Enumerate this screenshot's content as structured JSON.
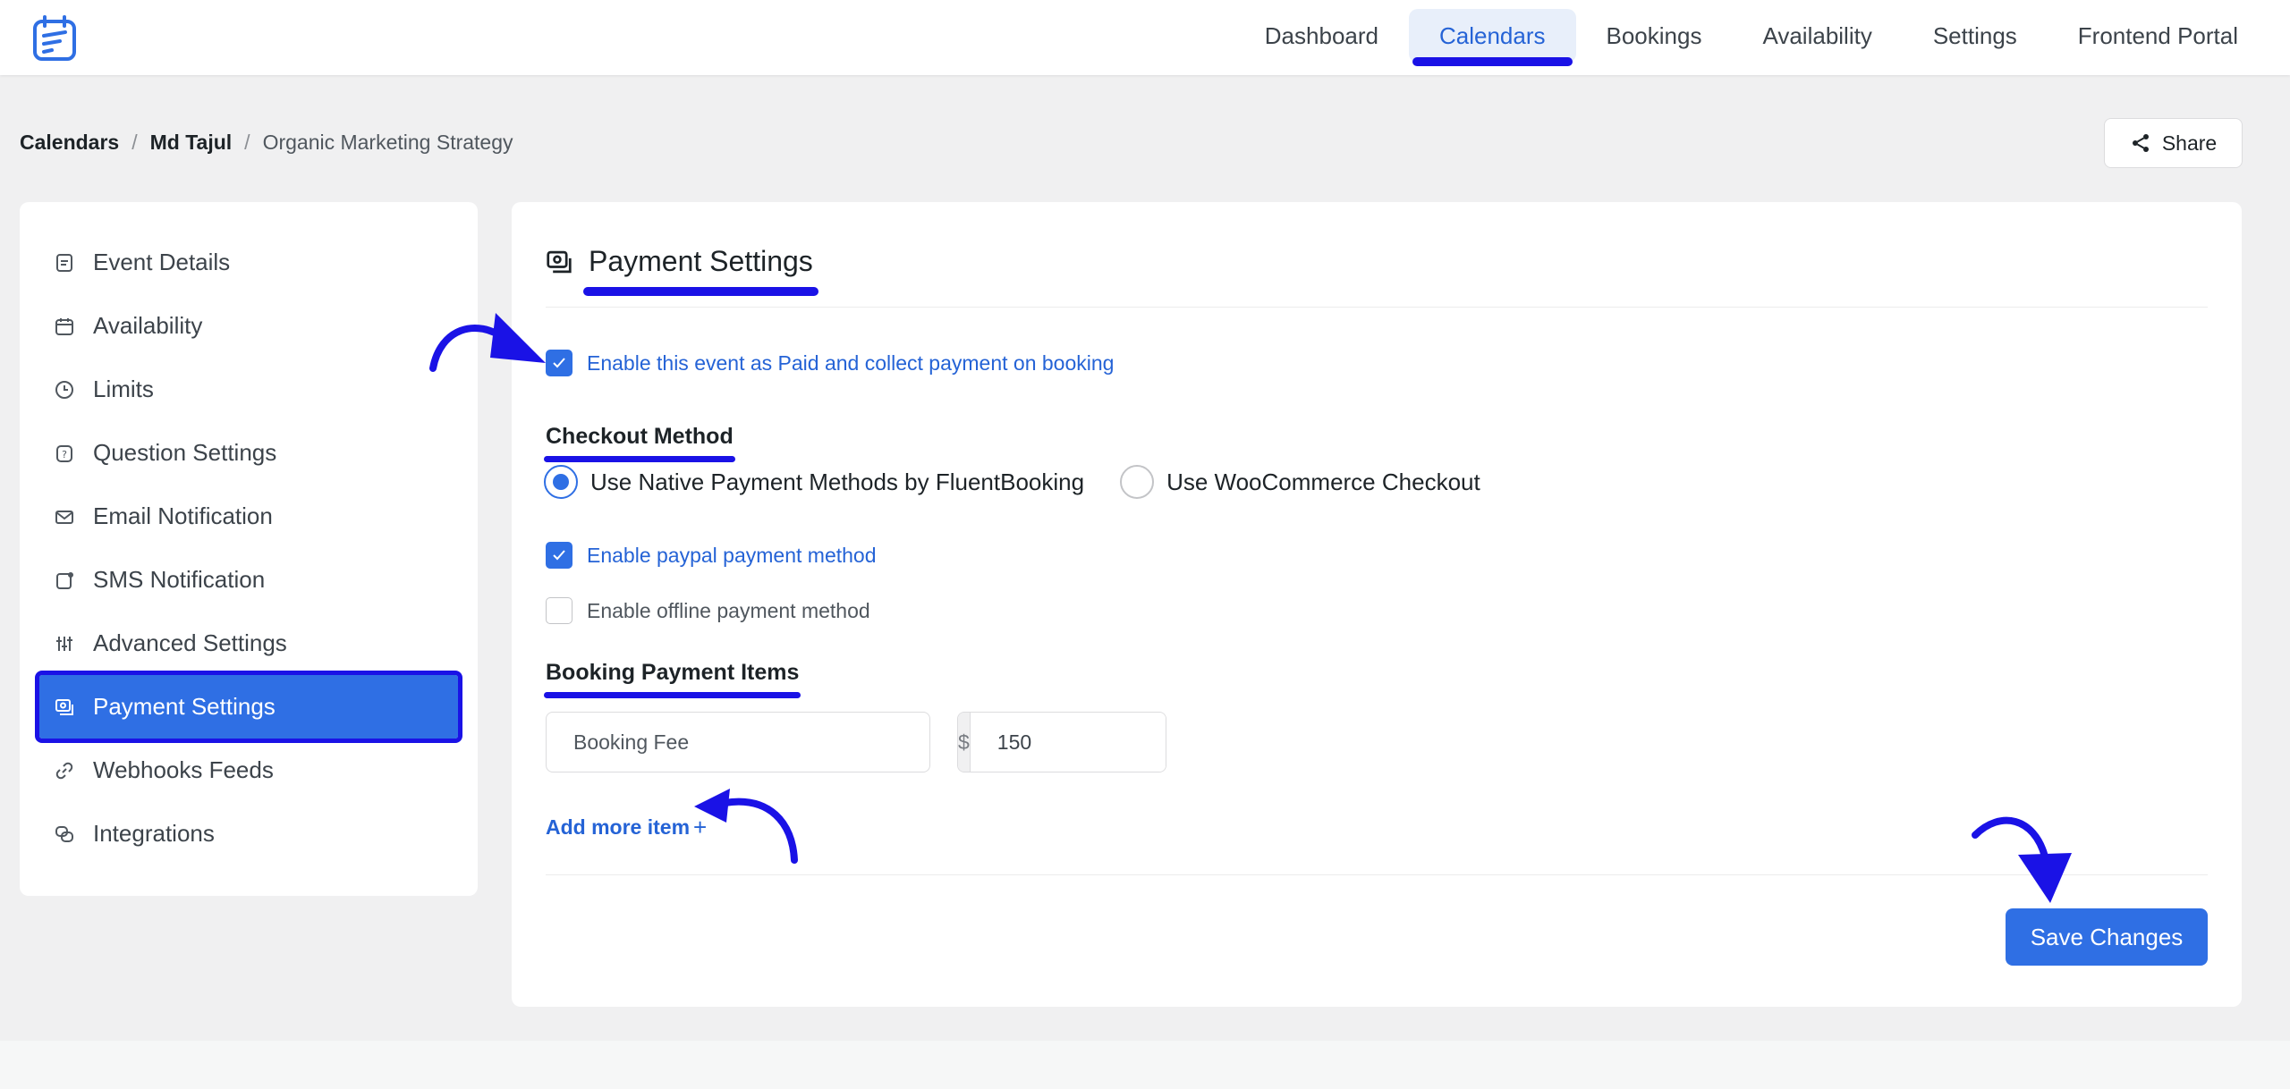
{
  "nav": {
    "items": [
      {
        "label": "Dashboard",
        "active": false
      },
      {
        "label": "Calendars",
        "active": true
      },
      {
        "label": "Bookings",
        "active": false
      },
      {
        "label": "Availability",
        "active": false
      },
      {
        "label": "Settings",
        "active": false
      },
      {
        "label": "Frontend Portal",
        "active": false
      }
    ]
  },
  "breadcrumb": {
    "root": "Calendars",
    "user": "Md Tajul",
    "event": "Organic Marketing Strategy",
    "separator": "/"
  },
  "share": {
    "label": "Share",
    "icon": "share-icon"
  },
  "sidebar": {
    "items": [
      {
        "label": "Event Details",
        "icon": "document-icon"
      },
      {
        "label": "Availability",
        "icon": "calendar-icon"
      },
      {
        "label": "Limits",
        "icon": "clock-icon"
      },
      {
        "label": "Question Settings",
        "icon": "question-icon"
      },
      {
        "label": "Email Notification",
        "icon": "mail-icon"
      },
      {
        "label": "SMS Notification",
        "icon": "sms-icon"
      },
      {
        "label": "Advanced Settings",
        "icon": "sliders-icon"
      },
      {
        "label": "Payment Settings",
        "icon": "payment-icon",
        "active": true
      },
      {
        "label": "Webhooks Feeds",
        "icon": "link-icon"
      },
      {
        "label": "Integrations",
        "icon": "integrations-icon"
      }
    ]
  },
  "payment": {
    "title": "Payment Settings",
    "enable_paid_label": "Enable this event as Paid and collect payment on booking",
    "enable_paid_checked": true,
    "checkout_method_title": "Checkout Method",
    "checkout_options": [
      {
        "label": "Use Native Payment Methods by FluentBooking",
        "selected": true
      },
      {
        "label": "Use WooCommerce Checkout",
        "selected": false
      }
    ],
    "paypal_label": "Enable paypal payment method",
    "paypal_checked": true,
    "offline_label": "Enable offline payment method",
    "offline_checked": false,
    "items_title": "Booking Payment Items",
    "item_name_value": "Booking Fee",
    "currency_symbol": "$",
    "item_price_value": "150",
    "add_more_label": "Add more item",
    "add_more_icon": "+",
    "save_label": "Save Changes"
  },
  "colors": {
    "accent": "#2f6fe4",
    "annotation": "#1a12e6",
    "link": "#2563d6"
  }
}
